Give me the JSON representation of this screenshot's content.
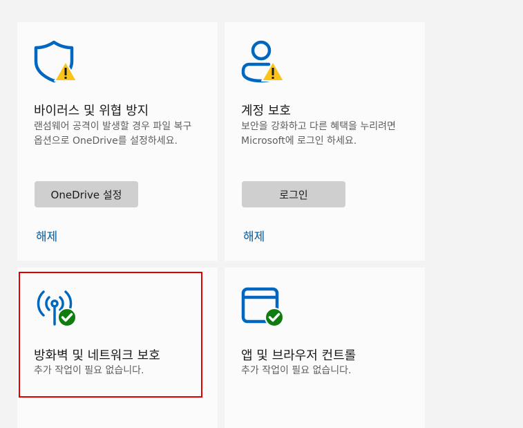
{
  "cards": [
    {
      "title": "바이러스 및 위협 방지",
      "description": "랜섬웨어 공격이 발생할 경우 파일 복구 옵션으로 OneDrive를 설정하세요.",
      "button_label": "OneDrive 설정",
      "link_label": "해제",
      "icon": "shield-warning-icon",
      "status": "warning"
    },
    {
      "title": "계정 보호",
      "description": "보안을 강화하고 다른 혜택을 누리려면 Microsoft에 로그인 하세요.",
      "button_label": "로그인",
      "link_label": "해제",
      "icon": "person-warning-icon",
      "status": "warning"
    },
    {
      "title": "방화벽 및 네트워크 보호",
      "description": "추가 작업이 필요 없습니다.",
      "icon": "antenna-ok-icon",
      "status": "ok",
      "highlighted": true
    },
    {
      "title": "앱 및 브라우저 컨트롤",
      "description": "추가 작업이 필요 없습니다.",
      "icon": "browser-ok-icon",
      "status": "ok"
    }
  ],
  "colors": {
    "accent": "#0067c0",
    "warning": "#fcc419",
    "ok": "#107c10",
    "highlight": "#e00000",
    "link": "#005a9e"
  }
}
